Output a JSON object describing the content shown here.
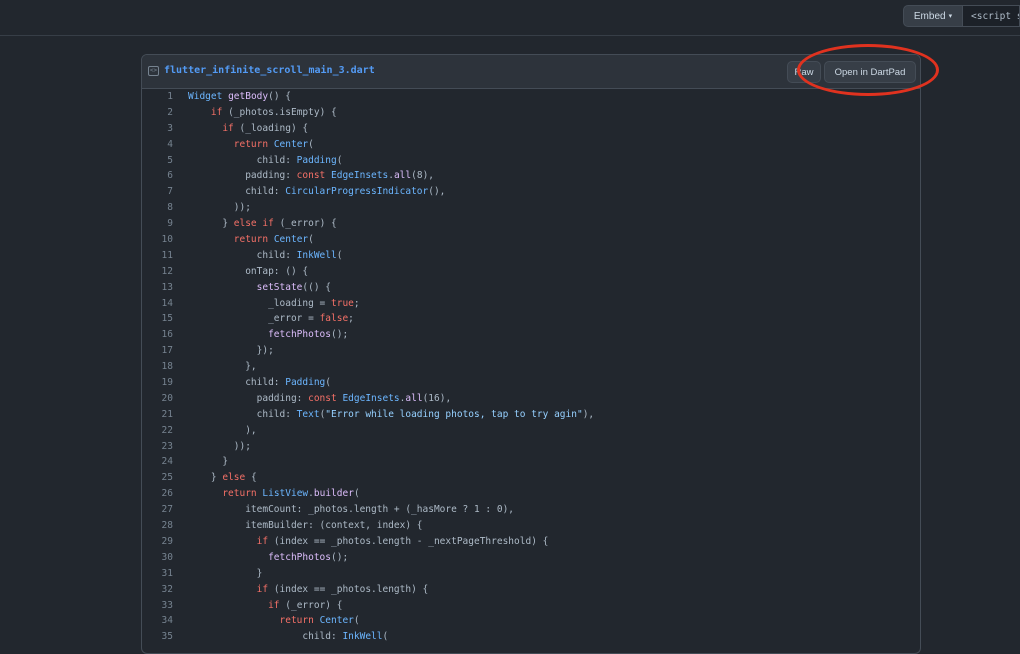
{
  "topbar": {
    "embed_label": "Embed",
    "embed_caret": "▾",
    "embed_snippet": "<script src=\"https://gist.github.com/"
  },
  "file": {
    "name": "flutter_infinite_scroll_main_3.dart",
    "raw_label": "Raw",
    "dartpad_label": "Open in DartPad"
  },
  "icons": {
    "file": "code-file-icon",
    "caret": "chevron-down-icon"
  },
  "colors": {
    "background": "#22272e",
    "header": "#2d333b",
    "filename": "#539bf5",
    "highlight_ring": "#e0321f",
    "keyword": "#f47067",
    "function": "#dcbdfb",
    "class": "#6cb6ff"
  },
  "code_lines": [
    {
      "n": "1",
      "t": "Widget getBody() {"
    },
    {
      "n": "2",
      "t": "    if (_photos.isEmpty) {"
    },
    {
      "n": "3",
      "t": "      if (_loading) {"
    },
    {
      "n": "4",
      "t": "        return Center("
    },
    {
      "n": "5",
      "t": "            child: Padding("
    },
    {
      "n": "6",
      "t": "          padding: const EdgeInsets.all(8),"
    },
    {
      "n": "7",
      "t": "          child: CircularProgressIndicator(),"
    },
    {
      "n": "8",
      "t": "        ));"
    },
    {
      "n": "9",
      "t": "      } else if (_error) {"
    },
    {
      "n": "10",
      "t": "        return Center("
    },
    {
      "n": "11",
      "t": "            child: InkWell("
    },
    {
      "n": "12",
      "t": "          onTap: () {"
    },
    {
      "n": "13",
      "t": "            setState(() {"
    },
    {
      "n": "14",
      "t": "              _loading = true;"
    },
    {
      "n": "15",
      "t": "              _error = false;"
    },
    {
      "n": "16",
      "t": "              fetchPhotos();"
    },
    {
      "n": "17",
      "t": "            });"
    },
    {
      "n": "18",
      "t": "          },"
    },
    {
      "n": "19",
      "t": "          child: Padding("
    },
    {
      "n": "20",
      "t": "            padding: const EdgeInsets.all(16),"
    },
    {
      "n": "21",
      "t": "            child: Text(\"Error while loading photos, tap to try agin\"),"
    },
    {
      "n": "22",
      "t": "          ),"
    },
    {
      "n": "23",
      "t": "        ));"
    },
    {
      "n": "24",
      "t": "      }"
    },
    {
      "n": "25",
      "t": "    } else {"
    },
    {
      "n": "26",
      "t": "      return ListView.builder("
    },
    {
      "n": "27",
      "t": "          itemCount: _photos.length + (_hasMore ? 1 : 0),"
    },
    {
      "n": "28",
      "t": "          itemBuilder: (context, index) {"
    },
    {
      "n": "29",
      "t": "            if (index == _photos.length - _nextPageThreshold) {"
    },
    {
      "n": "30",
      "t": "              fetchPhotos();"
    },
    {
      "n": "31",
      "t": "            }"
    },
    {
      "n": "32",
      "t": "            if (index == _photos.length) {"
    },
    {
      "n": "33",
      "t": "              if (_error) {"
    },
    {
      "n": "34",
      "t": "                return Center("
    },
    {
      "n": "35",
      "t": "                    child: InkWell("
    }
  ]
}
